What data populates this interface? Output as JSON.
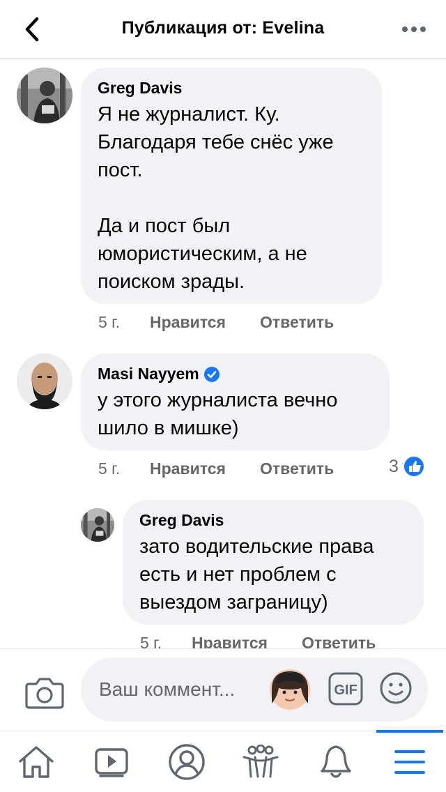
{
  "header": {
    "title": "Публикация от: Evelina",
    "back_icon": "chevron-left-icon",
    "more_icon": "more-horizontal-icon"
  },
  "comments": [
    {
      "author": "Greg Davis",
      "verified": false,
      "text": "Я не журналист. Ку.\nБлагодаря тебе снёс уже\nпост.\n\nДа и пост был\nюмористическим, а не\nпоиском зрады.",
      "time": "5 г.",
      "like_label": "Нравится",
      "reply_label": "Ответить"
    },
    {
      "author": "Masi Nayyem",
      "verified": true,
      "text": "у этого журналиста вечно\nшило в мишке)",
      "time": "5 г.",
      "like_label": "Нравится",
      "reply_label": "Ответить",
      "reaction_count": "3",
      "reaction_icon": "thumbs-up-icon"
    },
    {
      "author": "Greg Davis",
      "verified": false,
      "text": "зато водительские права\nесть и нет проблем с\nвыездом заграницу)",
      "time": "5 г.",
      "like_label": "Нравится",
      "reply_label": "Ответить"
    }
  ],
  "composer": {
    "placeholder": "Ваш коммент...",
    "camera_icon": "camera-icon",
    "avatar_icon": "avatar-sticker-icon",
    "gif_label": "GIF",
    "emoji_icon": "smiley-icon"
  },
  "tabs": [
    {
      "name": "home",
      "icon": "home-icon"
    },
    {
      "name": "watch",
      "icon": "video-icon"
    },
    {
      "name": "profile",
      "icon": "profile-icon"
    },
    {
      "name": "groups",
      "icon": "groups-icon"
    },
    {
      "name": "notifications",
      "icon": "bell-icon"
    },
    {
      "name": "menu",
      "icon": "menu-icon",
      "active": true
    }
  ],
  "colors": {
    "accent": "#1877f2",
    "bubble": "#f0f2f5",
    "secondary_text": "#65676b"
  }
}
